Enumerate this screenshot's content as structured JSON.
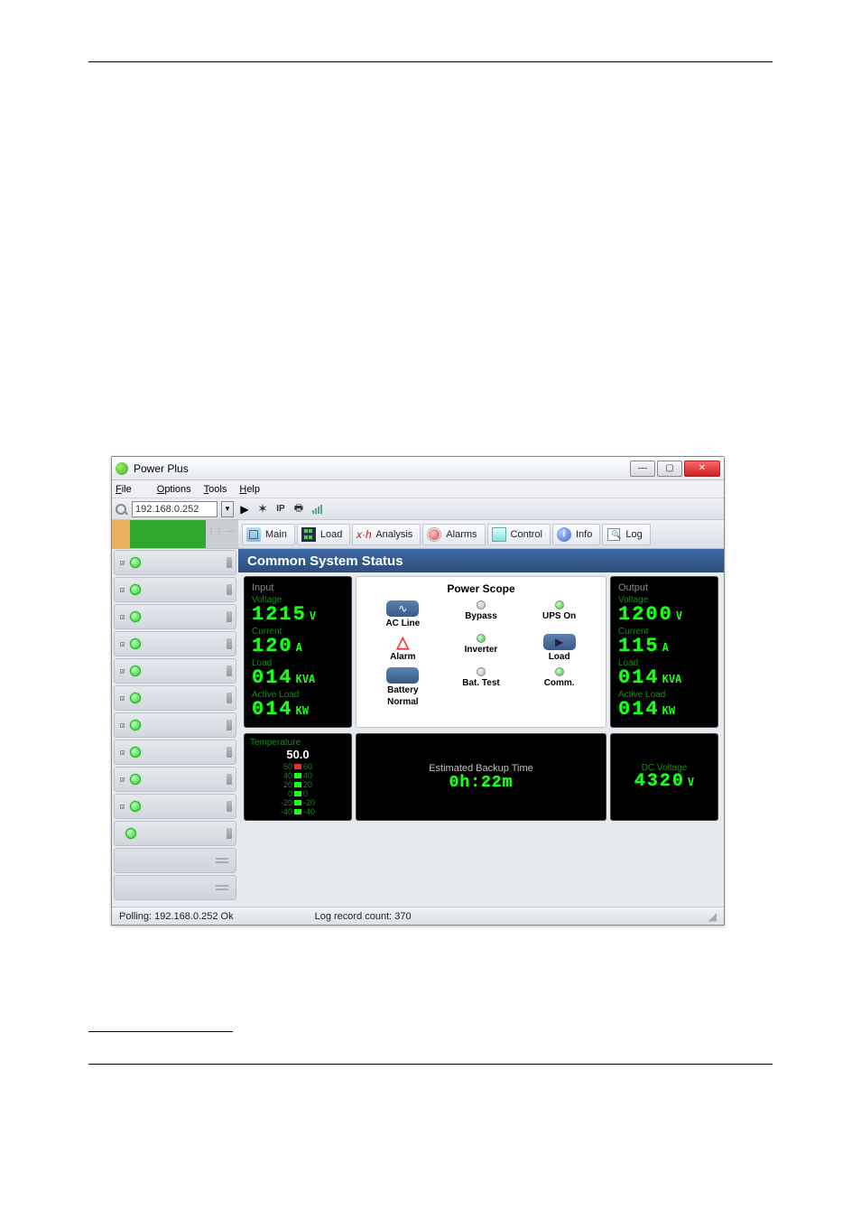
{
  "window": {
    "title": "Power Plus",
    "title_blur": [
      "",
      "",
      ""
    ]
  },
  "menu": {
    "file": "File",
    "options": "Options",
    "tools": "Tools",
    "help": "Help"
  },
  "toolbar": {
    "ip": "192.168.0.252",
    "ip_label": "IP"
  },
  "tabs": {
    "main": "Main",
    "load": "Load",
    "analysis": "Analysis",
    "alarms": "Alarms",
    "control": "Control",
    "info": "Info",
    "log": "Log"
  },
  "section_title": "Common System Status",
  "scope": {
    "title": "Power Scope",
    "acline": "AC Line",
    "bypass": "Bypass",
    "upson": "UPS On",
    "alarm": "Alarm",
    "inverter": "Inverter",
    "load": "Load",
    "battery": "Battery",
    "battest": "Bat. Test",
    "comm": "Comm.",
    "normal": "Normal"
  },
  "input": {
    "heading": "Input",
    "voltage_lbl": "Voltage",
    "voltage": "1215",
    "voltage_unit": "V",
    "current_lbl": "Current",
    "current": "120",
    "current_unit": "A",
    "load_lbl": "Load",
    "load": "014",
    "load_unit": "KVA",
    "active_lbl": "Active Load",
    "active": "014",
    "active_unit": "KW"
  },
  "output": {
    "heading": "Output",
    "voltage_lbl": "Voltage",
    "voltage": "1200",
    "voltage_unit": "V",
    "current_lbl": "Current",
    "current": "115",
    "current_unit": "A",
    "load_lbl": "Load",
    "load": "014",
    "load_unit": "KVA",
    "active_lbl": "Active Load",
    "active": "014",
    "active_unit": "KW"
  },
  "temp": {
    "heading": "Temperature",
    "value": "50.0",
    "ticks": [
      "60",
      "40",
      "20",
      "0",
      "-20",
      "-40"
    ]
  },
  "backup": {
    "heading": "Estimated Backup Time",
    "value": "0h:22m"
  },
  "dc": {
    "heading": "DC Voltage",
    "value": "4320",
    "unit": "V"
  },
  "status": {
    "polling": "Polling: 192.168.0.252 Ok",
    "log": "Log record count: 370"
  }
}
